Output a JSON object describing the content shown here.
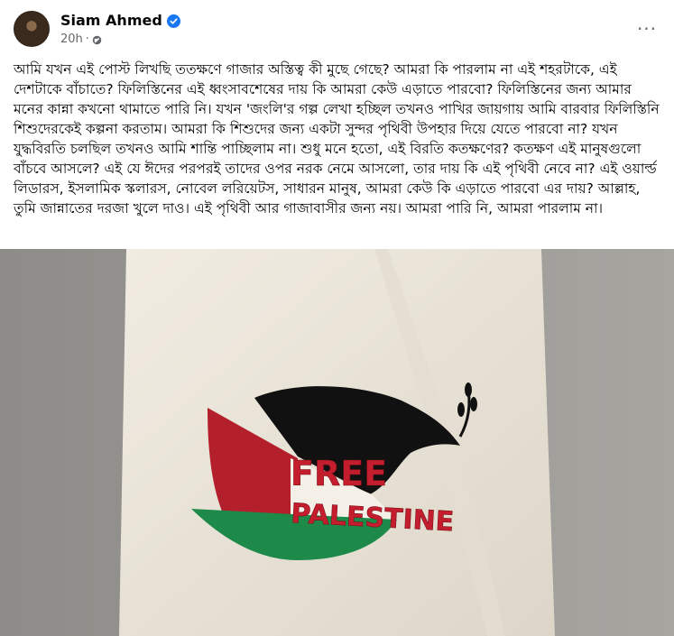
{
  "post": {
    "author": "Siam Ahmed",
    "time": "20h",
    "separator": "·",
    "more_label": "···",
    "text": "আমি যখন এই পোস্ট লিখছি ততক্ষণে গাজার অস্তিত্ব কী মুছে গেছে? আমরা কি পারলাম না এই শহরটাকে, এই দেশটাকে বাঁচাতে? ফিলিস্তিনের এই ধ্বংসাবশেষের দায় কি আমরা কেউ এড়াতে পারবো? ফিলিস্তিনের জন্য আমার মনের কান্না কখনো থামাতে পারি নি। যখন 'জংলি'র গল্প লেখা হচ্ছিল তখনও পাখির জায়গায় আমি বারবার ফিলিস্তিনি শিশুদেরকেই কল্পনা করতাম। আমরা কি শিশুদের জন্য একটা সুন্দর পৃথিবী উপহার দিয়ে যেতে পারবো না? যখন যুদ্ধবিরতি চলছিল তখনও আমি শান্তি পাচ্ছিলাম না। শুধু মনে হতো, এই বিরতি কতক্ষণের? কতক্ষণ এই মানুষগুলো বাঁচবে আসলে? এই যে ঈদের পরপরই তাদের ওপর নরক নেমে আসলো, তার দায় কি এই পৃথিবী নেবে না? এই ওয়ার্ল্ড লিডারস, ইসলামিক স্কলারস, নোবেল লরিয়েটস, সাধারন মানুষ, আমরা কেউ কি এড়াতে পারবো এর দায়? আল্লাহ, তুমি জান্নাতের দরজা খুলে দাও। এই পৃথিবী আর গাজাবাসীর জন্য নয়। আমরা পারি নি, আমরা পারলাম না।"
  },
  "image": {
    "embroidery_line1": "FREE",
    "embroidery_line2": "PALESTINE",
    "colors": {
      "shirt": "#ece7dc",
      "black": "#111111",
      "red": "#b3202b",
      "green": "#1d8a4a",
      "text": "#c41e2e"
    }
  },
  "colors": {
    "verified": "#1877f2",
    "meta_text": "#65676b"
  }
}
